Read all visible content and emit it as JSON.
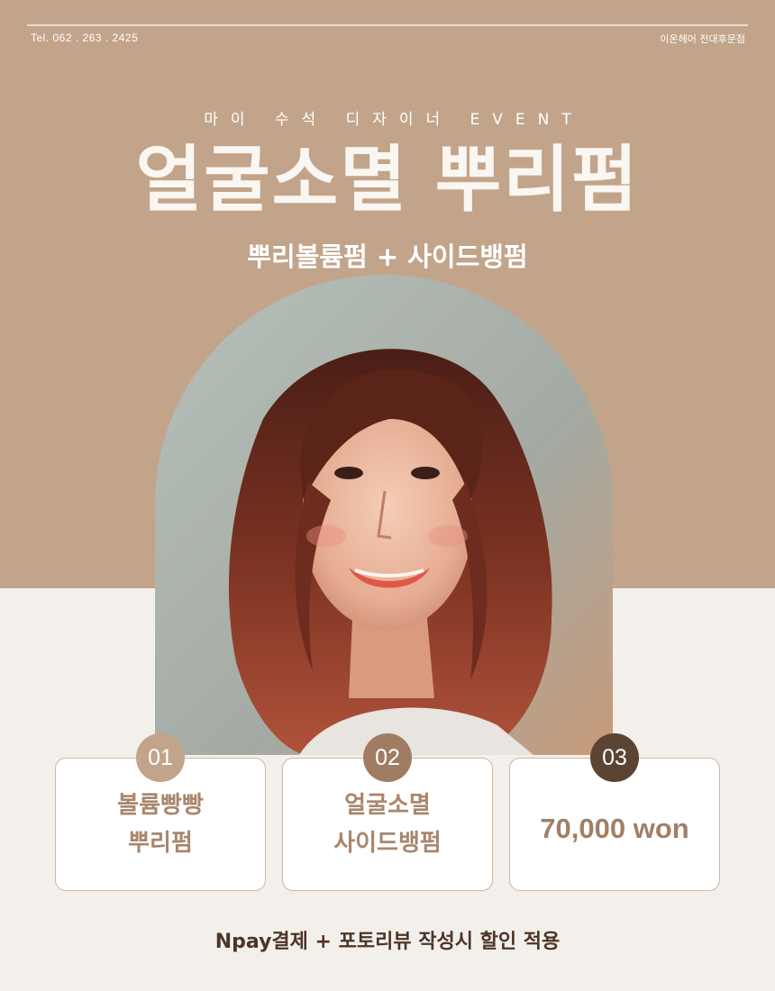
{
  "header": {
    "tel": "Tel. 062 . 263 . 2425",
    "salon_name": "이온헤어 전대후문점"
  },
  "hero": {
    "eyebrow": "마이 수석 디자이너 EVENT",
    "headline": "얼굴소멸 뿌리펌",
    "subhead": "뿌리볼륨펌 + 사이드뱅펌"
  },
  "portrait": {
    "icon": "woman-portrait-photo"
  },
  "cards": [
    {
      "number": "01",
      "line1": "볼륨빵빵",
      "line2": "뿌리펌",
      "badge_color": "#c2a48a"
    },
    {
      "number": "02",
      "line1": "얼굴소멸",
      "line2": "사이드뱅펌",
      "badge_color": "#a07d62"
    },
    {
      "number": "03",
      "price": "70,000 won",
      "badge_color": "#5c4434"
    }
  ],
  "footer": {
    "note": "Npay결제 + 포토리뷰 작성시 할인 적용"
  },
  "colors": {
    "top_background": "#c2a48a",
    "bottom_background": "#f3f0eb",
    "accent_text": "#a9866d",
    "footer_text": "#4d3426"
  }
}
